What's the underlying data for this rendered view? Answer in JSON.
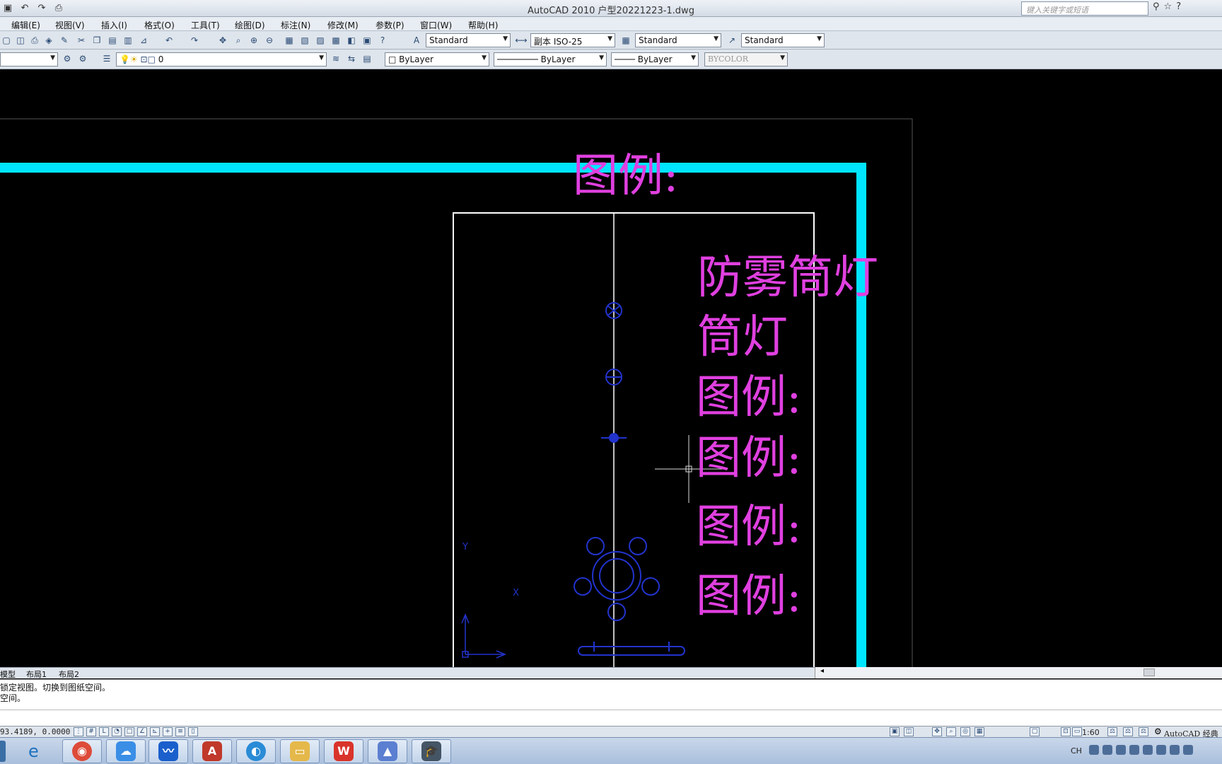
{
  "window": {
    "title": "AutoCAD 2010     户型20221223-1.dwg",
    "search_placeholder": "键入关键字或短语"
  },
  "menu": [
    "编辑(E)",
    "视图(V)",
    "插入(I)",
    "格式(O)",
    "工具(T)",
    "绘图(D)",
    "标注(N)",
    "修改(M)",
    "参数(P)",
    "窗口(W)",
    "帮助(H)"
  ],
  "toolbar": {
    "text_style": "Standard",
    "dim_style": "副本 ISO-25",
    "table_style": "Standard",
    "mleader_style": "Standard",
    "layer": "0",
    "color": "ByLayer",
    "linetype": "ByLayer",
    "lineweight": "ByLayer",
    "plotstyle": "BYCOLOR"
  },
  "drawing": {
    "legend_title": "图例:",
    "labels": [
      "防雾筒灯",
      "筒灯",
      "图例:",
      "图例:",
      "图例:",
      "图例:"
    ],
    "ucs_y": "Y",
    "ucs_x": "X",
    "border_color": "#00e5ff",
    "text_color": "#e040e0",
    "symbol_color": "#2233cc"
  },
  "tabs": [
    "模型",
    "布局1",
    "布局2"
  ],
  "command": {
    "line1": "锁定视图。切换到图纸空间。",
    "line2": "空间。"
  },
  "status": {
    "coordinates": "93.4189, 0.0000",
    "scale": "1:60",
    "workspace": "AutoCAD 经典"
  },
  "taskbar": {
    "apps": [
      {
        "icon": "ie-icon",
        "color": "#1e73be"
      },
      {
        "icon": "chrome-icon",
        "color": "#dd4b39"
      },
      {
        "icon": "baidu-netdisk-icon",
        "color": "#3a8ee6"
      },
      {
        "icon": "lanhu-icon",
        "color": "#1a5fcc"
      },
      {
        "icon": "autocad-icon",
        "color": "#c0392b"
      },
      {
        "icon": "browser-icon",
        "color": "#2a8bd6"
      },
      {
        "icon": "folder-icon",
        "color": "#e5b84a"
      },
      {
        "icon": "wps-icon",
        "color": "#d9342b"
      },
      {
        "icon": "mountain-app-icon",
        "color": "#5b7fd1"
      },
      {
        "icon": "graduation-icon",
        "color": "#445566"
      }
    ],
    "ime": "CH"
  }
}
